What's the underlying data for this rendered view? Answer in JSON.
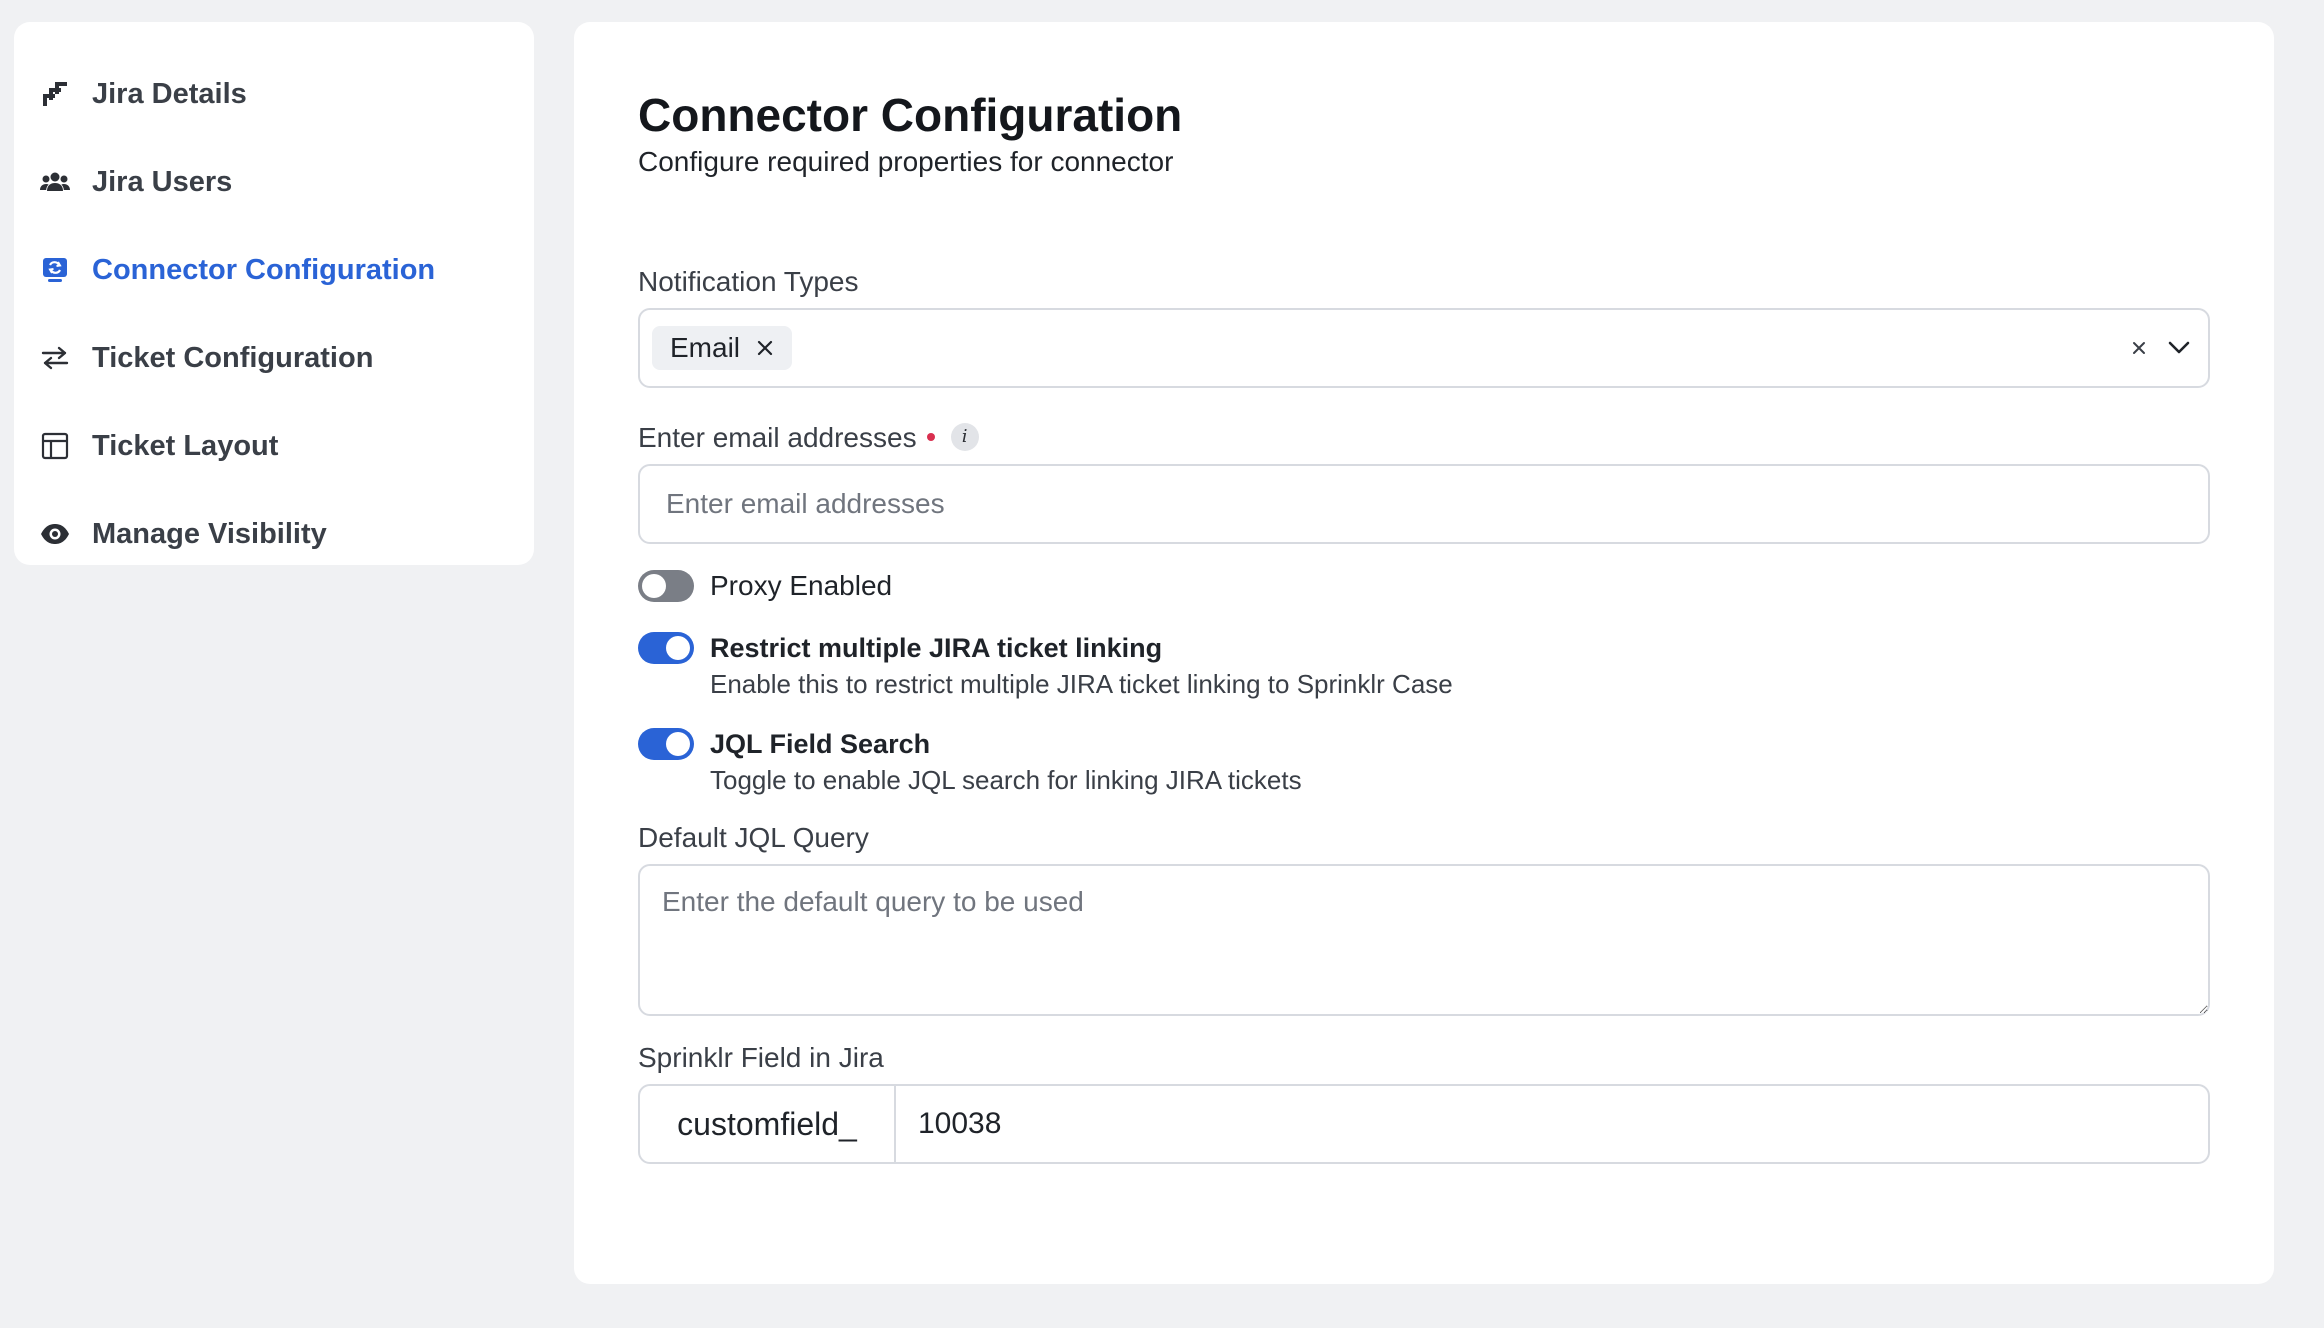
{
  "sidebar": {
    "items": [
      {
        "label": "Jira Details",
        "icon": "jira-logo-icon",
        "active": false
      },
      {
        "label": "Jira Users",
        "icon": "users-icon",
        "active": false
      },
      {
        "label": "Connector Configuration",
        "icon": "connector-icon",
        "active": true
      },
      {
        "label": "Ticket Configuration",
        "icon": "arrows-swap-icon",
        "active": false
      },
      {
        "label": "Ticket Layout",
        "icon": "layout-icon",
        "active": false
      },
      {
        "label": "Manage Visibility",
        "icon": "eye-icon",
        "active": false
      }
    ]
  },
  "main": {
    "title": "Connector Configuration",
    "subtitle": "Configure required properties for connector",
    "notification_types": {
      "label": "Notification Types",
      "selected": [
        "Email"
      ]
    },
    "email": {
      "label": "Enter email addresses",
      "placeholder": "Enter email addresses",
      "value": ""
    },
    "toggles": [
      {
        "label": "Proxy Enabled",
        "description": "",
        "on": false
      },
      {
        "label": "Restrict multiple JIRA ticket linking",
        "description": "Enable this to restrict multiple JIRA ticket linking to Sprinklr Case",
        "on": true
      },
      {
        "label": "JQL Field Search",
        "description": "Toggle to enable JQL search for linking JIRA tickets",
        "on": true
      }
    ],
    "jql_query": {
      "label": "Default JQL Query",
      "placeholder": "Enter the default query to be used"
    },
    "sprinklr_field": {
      "label": "Sprinklr Field in Jira",
      "prefix": "customfield_",
      "value": "10038"
    }
  },
  "colors": {
    "accent": "#2a63d6",
    "background": "#f0f1f3",
    "toggle_off": "#7a7e86",
    "required": "#d92f4f"
  }
}
